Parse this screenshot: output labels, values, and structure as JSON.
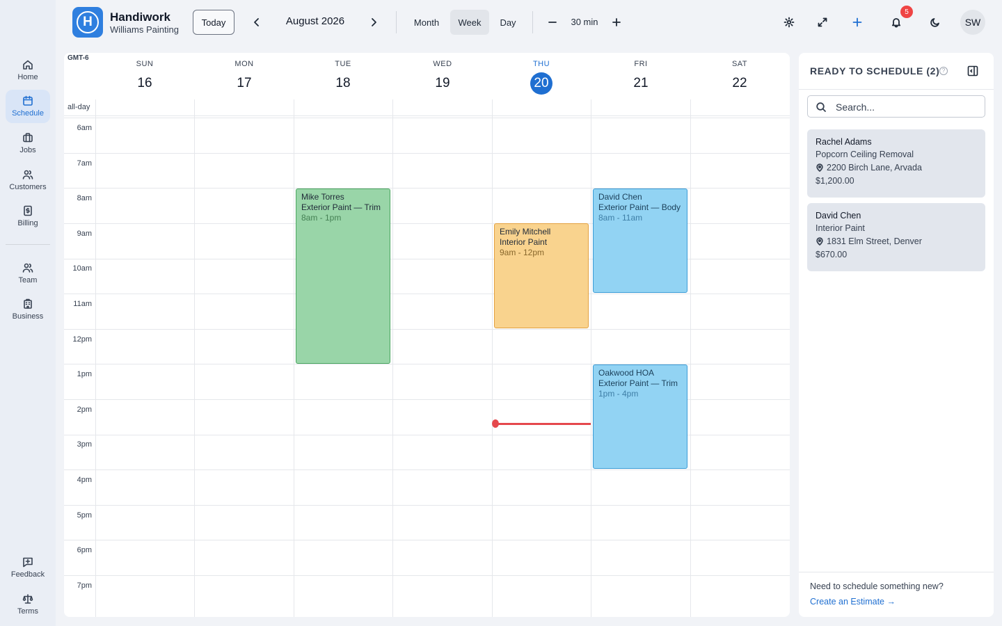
{
  "sidebar": {
    "items": [
      {
        "label": "Home",
        "icon": "home-icon"
      },
      {
        "label": "Schedule",
        "icon": "calendar-icon"
      },
      {
        "label": "Jobs",
        "icon": "briefcase-icon"
      },
      {
        "label": "Customers",
        "icon": "users-icon"
      },
      {
        "label": "Billing",
        "icon": "dollar-doc-icon"
      },
      {
        "label": "Team",
        "icon": "team-icon"
      },
      {
        "label": "Business",
        "icon": "building-icon"
      },
      {
        "label": "Feedback",
        "icon": "feedback-icon"
      },
      {
        "label": "Terms",
        "icon": "scale-icon"
      }
    ],
    "active": "Schedule"
  },
  "header": {
    "brand": "Handiwork",
    "business": "Williams Painting",
    "today_label": "Today",
    "month": "August 2026",
    "views": [
      "Month",
      "Week",
      "Day"
    ],
    "active_view": "Week",
    "interval": "30 min",
    "notifications_count": "5",
    "avatar_initials": "SW"
  },
  "calendar": {
    "timezone": "GMT-6",
    "allday_label": "all-day",
    "days": [
      {
        "name": "SUN",
        "num": "16"
      },
      {
        "name": "MON",
        "num": "17"
      },
      {
        "name": "TUE",
        "num": "18"
      },
      {
        "name": "WED",
        "num": "19"
      },
      {
        "name": "THU",
        "num": "20",
        "today": true
      },
      {
        "name": "FRI",
        "num": "21"
      },
      {
        "name": "SAT",
        "num": "22"
      }
    ],
    "hours": [
      "6am",
      "7am",
      "8am",
      "9am",
      "10am",
      "11am",
      "12pm",
      "1pm",
      "2pm",
      "3pm",
      "4pm",
      "5pm",
      "6pm",
      "7pm"
    ],
    "events": [
      {
        "customer": "Mike Torres",
        "service": "Exterior Paint — Trim",
        "time": "8am - 1pm",
        "day": "TUE",
        "color": "green"
      },
      {
        "customer": "Emily Mitchell",
        "service": "Interior Paint",
        "time": "9am - 12pm",
        "day": "THU",
        "color": "orange"
      },
      {
        "customer": "David Chen",
        "service": "Exterior Paint — Body",
        "time": "8am - 11am",
        "day": "FRI",
        "color": "blue"
      },
      {
        "customer": "Oakwood HOA",
        "service": "Exterior Paint — Trim",
        "time": "1pm - 4pm",
        "day": "FRI",
        "color": "blue"
      }
    ]
  },
  "panel": {
    "title": "READY TO SCHEDULE (2)",
    "search_placeholder": "Search...",
    "cards": [
      {
        "name": "Rachel Adams",
        "job": "Popcorn Ceiling Removal",
        "address": "2200 Birch Lane, Arvada",
        "price": "$1,200.00"
      },
      {
        "name": "David Chen",
        "job": "Interior Paint",
        "address": "1831 Elm Street, Denver",
        "price": "$670.00"
      }
    ],
    "footer_text": "Need to schedule something new?",
    "footer_link": "Create an Estimate →"
  },
  "colors": {
    "accent": "#1f6fd1",
    "event_green": "#99d5a8",
    "event_orange": "#f9d38e",
    "event_blue": "#92d3f3",
    "now_line": "#e5484d"
  }
}
